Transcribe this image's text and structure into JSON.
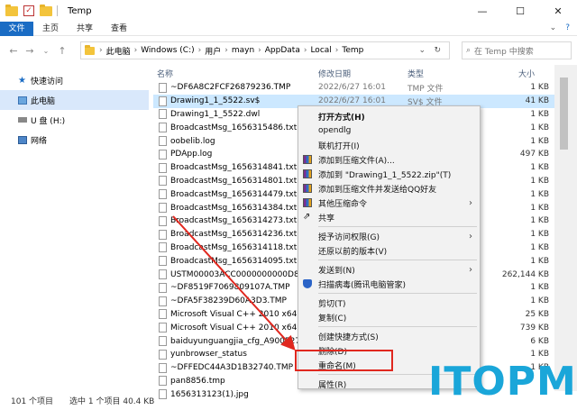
{
  "window": {
    "title": "Temp",
    "controls": [
      "—",
      "☐",
      "✕"
    ]
  },
  "ribbon": {
    "tabs": [
      "文件",
      "主页",
      "共享",
      "查看"
    ]
  },
  "address": {
    "path": [
      "此电脑",
      "Windows (C:)",
      "用户",
      "mayn",
      "AppData",
      "Local",
      "Temp"
    ],
    "search_placeholder": "在 Temp 中搜索"
  },
  "sidebar": {
    "items": [
      "快速访问",
      "此电脑",
      "U 盘 (H:)",
      "网络"
    ],
    "selected_index": 1
  },
  "columns": {
    "name": "名称",
    "date": "修改日期",
    "type": "类型",
    "size": "大小"
  },
  "files": [
    {
      "name": "~DF6A8C2FCF26879236.TMP",
      "date": "2022/6/27 16:01",
      "type": "TMP 文件",
      "size": "1 KB"
    },
    {
      "name": "Drawing1_1_5522.sv$",
      "date": "2022/6/27 16:01",
      "type": "SV$ 文件",
      "size": "41 KB"
    },
    {
      "name": "Drawing1_1_5522.dwl",
      "date": "",
      "type": "",
      "size": "1 KB"
    },
    {
      "name": "BroadcastMsg_1656315486.txt",
      "date": "",
      "type": "",
      "size": "1 KB"
    },
    {
      "name": "oobelib.log",
      "date": "",
      "type": "",
      "size": "1 KB"
    },
    {
      "name": "PDApp.log",
      "date": "",
      "type": "",
      "size": "497 KB"
    },
    {
      "name": "BroadcastMsg_1656314841.txt",
      "date": "",
      "type": "",
      "size": "1 KB"
    },
    {
      "name": "BroadcastMsg_1656314801.txt",
      "date": "",
      "type": "",
      "size": "1 KB"
    },
    {
      "name": "BroadcastMsg_1656314479.txt",
      "date": "",
      "type": "",
      "size": "1 KB"
    },
    {
      "name": "BroadcastMsg_1656314384.txt",
      "date": "",
      "type": "",
      "size": "1 KB"
    },
    {
      "name": "BroadcastMsg_1656314273.txt",
      "date": "",
      "type": "",
      "size": "1 KB"
    },
    {
      "name": "BroadcastMsg_1656314236.txt",
      "date": "",
      "type": "",
      "size": "1 KB"
    },
    {
      "name": "BroadcastMsg_1656314118.txt",
      "date": "",
      "type": "",
      "size": "1 KB"
    },
    {
      "name": "BroadcastMsg_1656314095.txt",
      "date": "",
      "type": "",
      "size": "1 KB"
    },
    {
      "name": "USTM00003ACC0000000000D8A4FC",
      "date": "",
      "type": "",
      "size": "262,144 KB"
    },
    {
      "name": "~DF8519F7069809107A.TMP",
      "date": "",
      "type": "",
      "size": "1 KB"
    },
    {
      "name": "~DFA5F38239D60A3D3.TMP",
      "date": "",
      "type": "",
      "size": "1 KB"
    },
    {
      "name": "Microsoft Visual C++ 2010 x64 Re",
      "date": "",
      "type": "",
      "size": "25 KB"
    },
    {
      "name": "Microsoft Visual C++ 2010 x64 Re",
      "date": "",
      "type": "",
      "size": "739 KB"
    },
    {
      "name": "baiduyunguangjia_cfg_A900527CB",
      "date": "",
      "type": "",
      "size": "6 KB"
    },
    {
      "name": "yunbrowser_status",
      "date": "",
      "type": "",
      "size": "1 KB"
    },
    {
      "name": "~DFFEDC44A3D1B32740.TMP",
      "date": "",
      "type": "",
      "size": "1 KB"
    },
    {
      "name": "pan8856.tmp",
      "date": "",
      "type": "",
      "size": ""
    },
    {
      "name": "1656313123(1).jpg",
      "date": "",
      "type": "",
      "size": ""
    }
  ],
  "selected_file_index": 1,
  "context_menu": [
    {
      "label": "打开方式(H)",
      "bold": true,
      "icon": "",
      "arrow": false
    },
    {
      "label": "opendlg",
      "icon": "",
      "arrow": false
    },
    {
      "label": "联机打开(I)",
      "icon": "",
      "arrow": false
    },
    {
      "label": "添加到压缩文件(A)...",
      "icon": "rar-icon",
      "arrow": false
    },
    {
      "label": "添加到 \"Drawing1_1_5522.zip\"(T)",
      "icon": "rar-icon",
      "arrow": false
    },
    {
      "label": "添加到压缩文件并发送给QQ好友",
      "icon": "rar-icon",
      "arrow": false
    },
    {
      "label": "其他压缩命令",
      "icon": "rar-icon",
      "arrow": true
    },
    {
      "label": "共享",
      "icon": "share-icon",
      "arrow": false
    },
    {
      "sep": true
    },
    {
      "label": "授予访问权限(G)",
      "icon": "",
      "arrow": true
    },
    {
      "label": "还原以前的版本(V)",
      "icon": "",
      "arrow": false
    },
    {
      "sep": true
    },
    {
      "label": "发送到(N)",
      "icon": "",
      "arrow": true
    },
    {
      "label": "扫描病毒(腾讯电脑管家)",
      "icon": "shield-icon",
      "arrow": false
    },
    {
      "sep": true
    },
    {
      "label": "剪切(T)",
      "icon": "",
      "arrow": false
    },
    {
      "label": "复制(C)",
      "icon": "",
      "arrow": false
    },
    {
      "sep": true
    },
    {
      "label": "创建快捷方式(S)",
      "icon": "",
      "arrow": false
    },
    {
      "label": "删除(D)",
      "icon": "",
      "arrow": false
    },
    {
      "label": "重命名(M)",
      "icon": "",
      "arrow": false,
      "highlighted": true
    },
    {
      "sep": true
    },
    {
      "label": "属性(R)",
      "icon": "",
      "arrow": false
    }
  ],
  "status": {
    "count": "101 个项目",
    "selection": "选中 1 个项目 40.4 KB"
  },
  "watermark": "ITOPM",
  "colors": {
    "accent": "#1a6cc4",
    "selection": "#cce8ff",
    "highlight_box": "#e0281f",
    "watermark": "#1aa6d9"
  }
}
